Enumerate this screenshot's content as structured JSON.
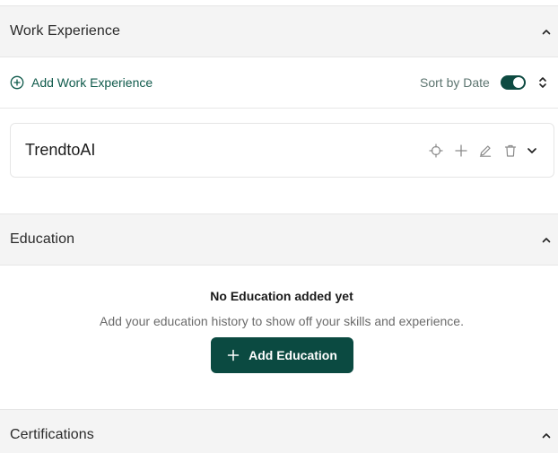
{
  "work_experience": {
    "title": "Work Experience",
    "add_label": "Add Work Experience",
    "sort_label": "Sort by Date",
    "sort_enabled": true,
    "entries": [
      {
        "name": "TrendtoAI"
      }
    ]
  },
  "education": {
    "title": "Education",
    "empty_title": "No Education added yet",
    "empty_description": "Add your education history to show off your skills and experience.",
    "add_button_label": "Add Education"
  },
  "certifications": {
    "title": "Certifications"
  },
  "colors": {
    "accent": "#0b4a41",
    "accent_text": "#0f5a4b",
    "header_bg": "#f4f4f4"
  },
  "icons": {
    "collapse": "chevron-up-icon",
    "add_circle": "plus-circle-icon",
    "sort": "chevron-up-down-icon",
    "target": "crosshair-icon",
    "add": "plus-icon",
    "edit": "pencil-icon",
    "delete": "trash-icon",
    "expand": "chevron-down-icon"
  }
}
